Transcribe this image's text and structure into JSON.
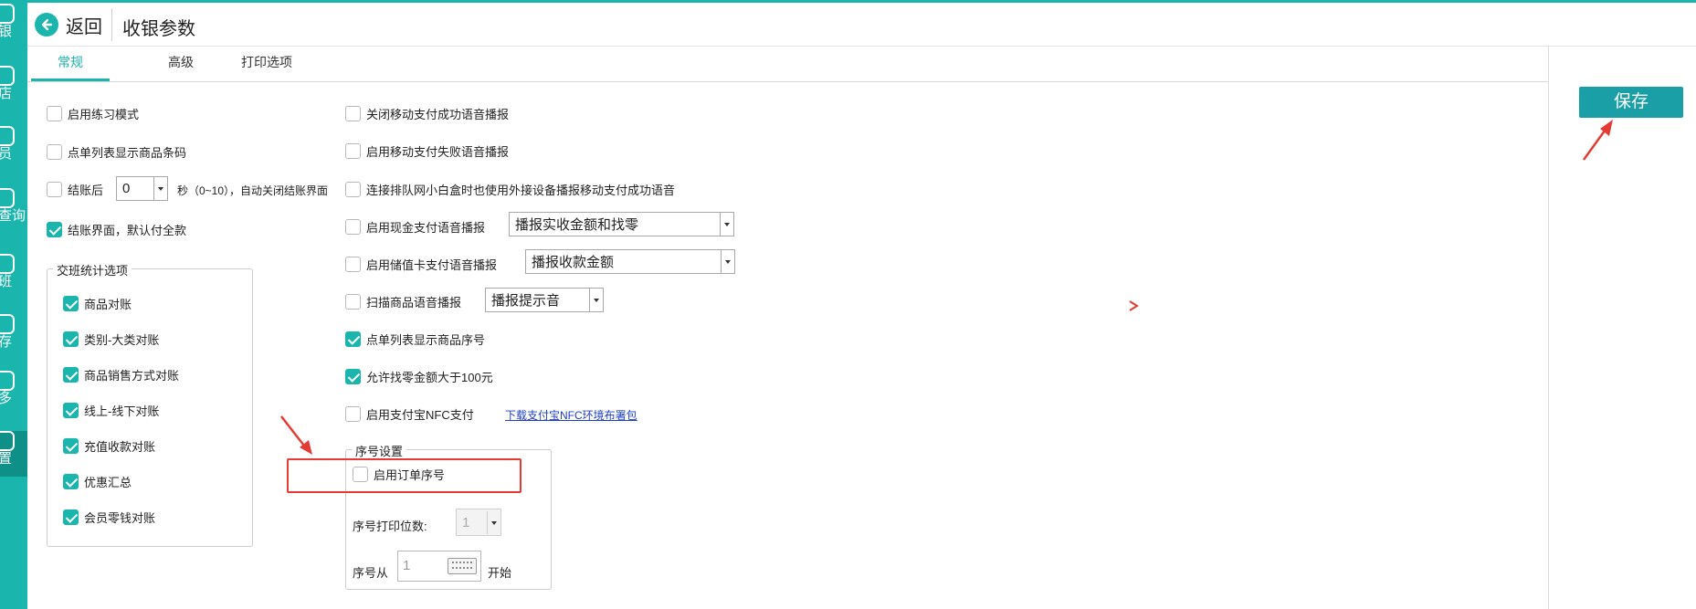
{
  "header": {
    "back_label": "返回",
    "title": "收银参数"
  },
  "sidebar": {
    "items": [
      {
        "label": "银"
      },
      {
        "label": "店"
      },
      {
        "label": "员"
      },
      {
        "label": "查询"
      },
      {
        "label": "班"
      },
      {
        "label": "存"
      },
      {
        "label": "多"
      },
      {
        "label": "置"
      }
    ]
  },
  "tabs": [
    {
      "label": "常规",
      "active": true
    },
    {
      "label": "高级"
    },
    {
      "label": "打印选项"
    }
  ],
  "toolbar": {
    "save_label": "保存"
  },
  "left_options": {
    "practice_mode": {
      "label": "启用练习模式",
      "checked": false
    },
    "show_barcode": {
      "label": "点单列表显示商品条码",
      "checked": false
    },
    "auto_close": {
      "label": "结账后",
      "checked": false,
      "value": "0",
      "suffix": "秒（0~10），自动关闭结账界面"
    },
    "default_full": {
      "label": "结账界面，默认付全款",
      "checked": true
    }
  },
  "shift_stats": {
    "title": "交班统计选项",
    "items": [
      {
        "label": "商品对账",
        "checked": true
      },
      {
        "label": "类别-大类对账",
        "checked": true
      },
      {
        "label": "商品销售方式对账",
        "checked": true
      },
      {
        "label": "线上-线下对账",
        "checked": true
      },
      {
        "label": "充值收款对账",
        "checked": true
      },
      {
        "label": "优惠汇总",
        "checked": true
      },
      {
        "label": "会员零钱对账",
        "checked": true
      }
    ]
  },
  "right_options": {
    "close_mobile_voice": {
      "label": "关闭移动支付成功语音播报",
      "checked": false
    },
    "mobile_fail_voice": {
      "label": "启用移动支付失败语音播报",
      "checked": false
    },
    "queue_box_voice": {
      "label": "连接排队网小白盒时也使用外接设备播报移动支付成功语音",
      "checked": false
    },
    "cash_voice": {
      "label": "启用现金支付语音播报",
      "checked": false,
      "select": "播报实收金额和找零"
    },
    "card_voice": {
      "label": "启用储值卡支付语音播报",
      "checked": false,
      "select": "播报收款金额"
    },
    "scan_voice": {
      "label": "扫描商品语音播报",
      "checked": false,
      "select": "播报提示音"
    },
    "show_seq": {
      "label": "点单列表显示商品序号",
      "checked": true
    },
    "allow_change": {
      "label": "允许找零金额大于100元",
      "checked": true
    },
    "alipay_nfc": {
      "label": "启用支付宝NFC支付",
      "checked": false,
      "link": "下载支付宝NFC环境布署包"
    }
  },
  "serial_settings": {
    "title": "序号设置",
    "enable_order_serial": {
      "label": "启用订单序号",
      "checked": false
    },
    "digits_label": "序号打印位数:",
    "digits_value": "1",
    "start_label": "序号从",
    "start_value": "1",
    "start_suffix": "开始"
  },
  "colors": {
    "accent": "#1ab5ac",
    "save": "#1a9fa6",
    "annotation": "#e43b35",
    "link": "#1f3ec9"
  },
  "icons": [
    "back-arrow-icon",
    "keyboard-icon",
    "dropdown-arrow-icon",
    "check-icon",
    "annotation-arrow-icon"
  ]
}
